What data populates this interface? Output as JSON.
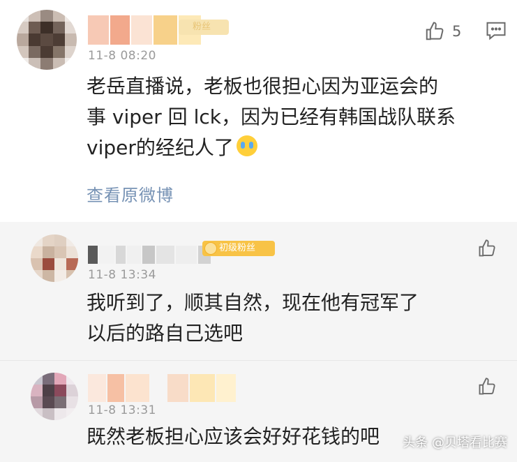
{
  "comments": [
    {
      "avatar_icon": "user-avatar-icon",
      "fan_badge": "粉丝",
      "time": "11-8 08:20",
      "text_lines": [
        "老岳直播说，老板也很担心因为亚运会的",
        "事 viper 回 lck，因为已经有韩国战队联系",
        "viper的经纪人了"
      ],
      "emoji": "crying-face",
      "view_original": "查看原微博",
      "like_count": "5",
      "colors": [
        "#8b7c74",
        "#f0d9cf",
        "#3a2d26"
      ]
    },
    {
      "avatar_icon": "user-avatar-icon",
      "fan_badge": "初级粉丝",
      "time": "11-8 13:34",
      "text_lines": [
        "我听到了，顺其自然，现在他有冠军了",
        "以后的路自己选吧"
      ]
    },
    {
      "avatar_icon": "user-avatar-icon",
      "time": "11-8 13:31",
      "text_lines": [
        "既然老板担心应该会好好花钱的吧"
      ]
    }
  ],
  "watermark": "头条 @贝塔看比赛",
  "accent_colors": {
    "link": "#5f7fa8",
    "badge": "#f8c346",
    "text": "#222222",
    "meta": "#9a9a9a"
  }
}
